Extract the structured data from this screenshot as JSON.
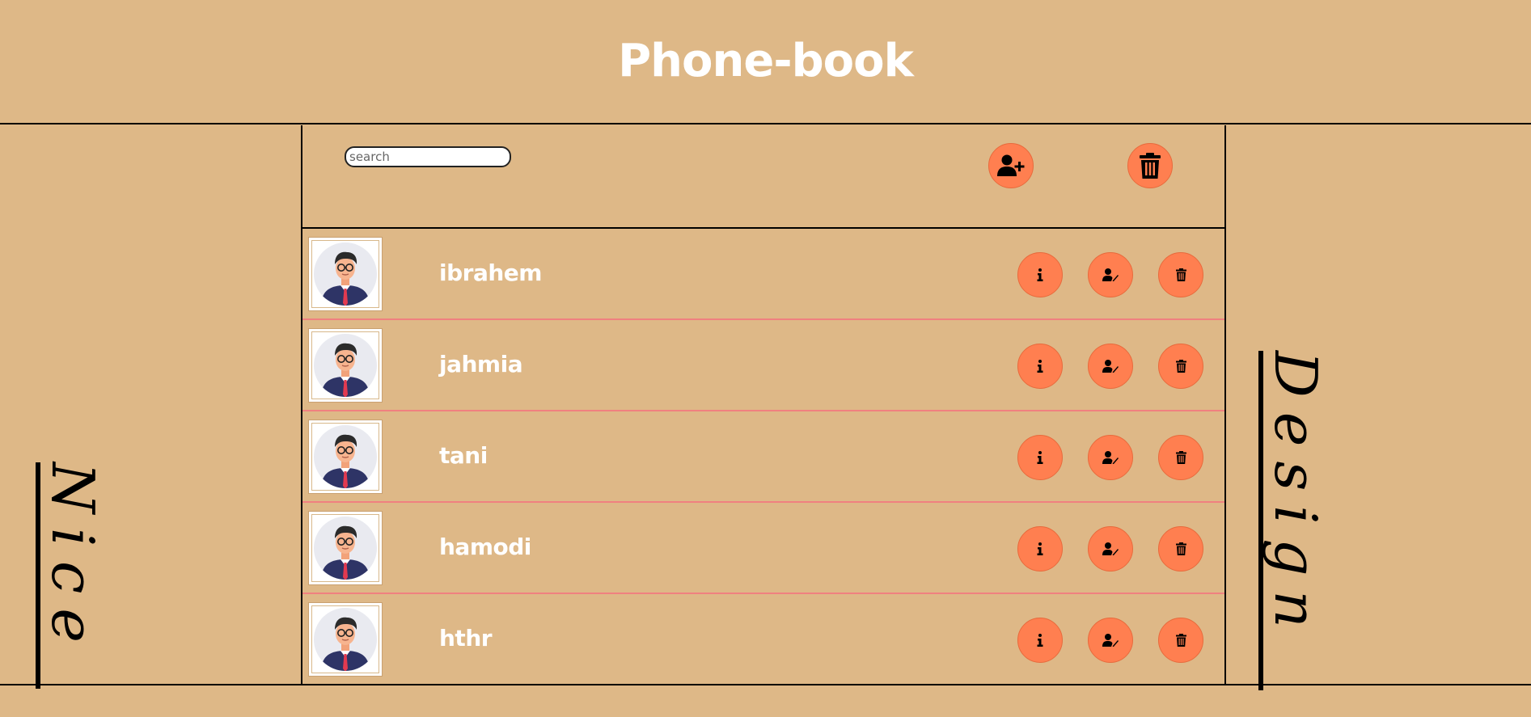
{
  "header": {
    "title": "Phone-book"
  },
  "toolbar": {
    "search_placeholder": "search",
    "add_icon": "user-plus-icon",
    "delete_all_icon": "trash-icon"
  },
  "contacts": [
    {
      "name": "ibrahem"
    },
    {
      "name": "jahmia"
    },
    {
      "name": "tani"
    },
    {
      "name": "hamodi"
    },
    {
      "name": "hthr"
    }
  ],
  "side": {
    "left_text": "Nice",
    "right_text": "Design"
  },
  "colors": {
    "background": "#deb887",
    "button": "#ff7f50",
    "row_divider": "#f08080",
    "title": "#ffffff"
  }
}
